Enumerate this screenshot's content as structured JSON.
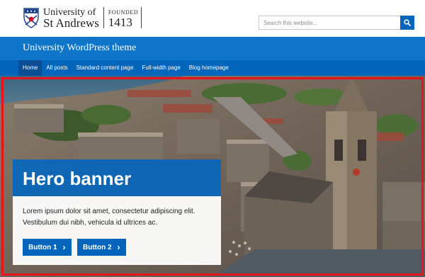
{
  "header": {
    "logo": {
      "name_line1": "University of",
      "name_line2": "St Andrews",
      "founded_label": "FOUNDED",
      "founded_year": "1413"
    },
    "search": {
      "placeholder": "Search this website...",
      "icon": "search-icon"
    }
  },
  "site": {
    "title": "University WordPress theme"
  },
  "nav": {
    "items": [
      {
        "label": "Home",
        "active": true
      },
      {
        "label": "All posts",
        "active": false
      },
      {
        "label": "Standard content page",
        "active": false
      },
      {
        "label": "Full-width page",
        "active": false
      },
      {
        "label": "Blog homepage",
        "active": false
      }
    ]
  },
  "hero": {
    "title": "Hero banner",
    "text": "Lorem ipsum dolor sit amet, consectetur adipiscing elit. Vestibulum dui nibh, vehicula id ultrices ac.",
    "buttons": [
      {
        "label": "Button 1",
        "icon": "chevron-right-icon"
      },
      {
        "label": "Button 2",
        "icon": "chevron-right-icon"
      }
    ]
  },
  "colors": {
    "brand_blue": "#0466bb",
    "site_bar": "#0e75c9",
    "nav_active": "#0a4f93",
    "highlight_frame": "#e8141c"
  }
}
